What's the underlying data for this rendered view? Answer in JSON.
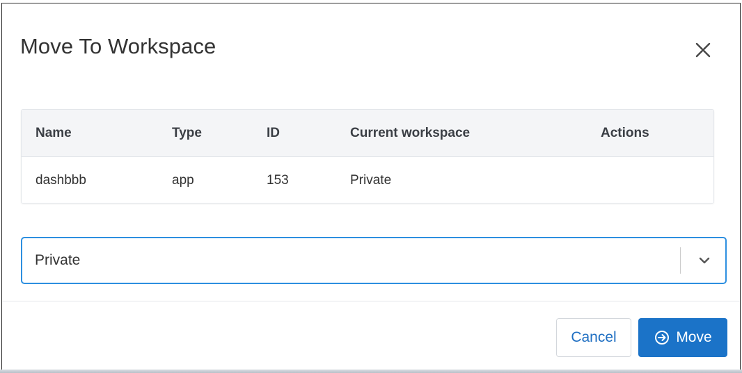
{
  "dialog": {
    "title": "Move To Workspace",
    "close_icon": "close-icon"
  },
  "table": {
    "headers": [
      "Name",
      "Type",
      "ID",
      "Current workspace",
      "Actions"
    ],
    "rows": [
      {
        "name": "dashbbb",
        "type": "app",
        "id": "153",
        "current_workspace": "Private",
        "actions": ""
      }
    ]
  },
  "workspace_select": {
    "selected": "Private",
    "icon": "chevron-down-icon"
  },
  "footer": {
    "cancel_label": "Cancel",
    "move_label": "Move",
    "move_icon": "arrow-circle-right-icon"
  },
  "colors": {
    "accent": "#1b73c8",
    "focus_border": "#2d8fe0",
    "header_bg": "#f4f5f7"
  }
}
